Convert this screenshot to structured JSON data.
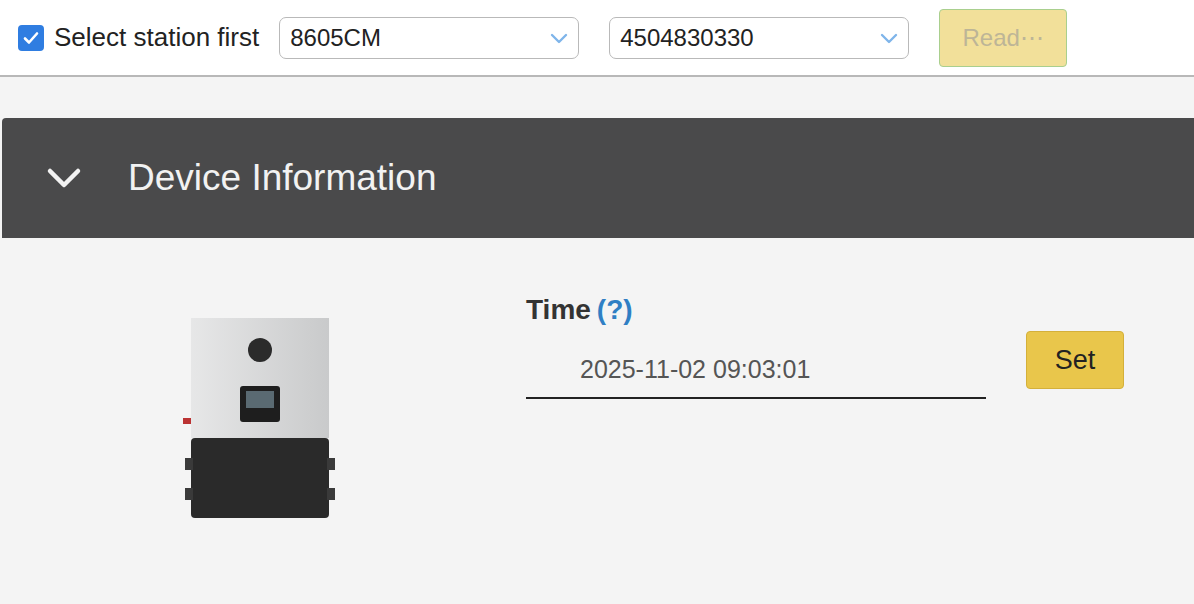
{
  "top_bar": {
    "select_station_first": {
      "label": "Select station first",
      "checked": true
    },
    "station_select": {
      "value": "8605CM"
    },
    "device_select": {
      "value": "4504830330"
    },
    "read_button": {
      "label": "Read⋯",
      "disabled": true
    }
  },
  "section": {
    "title": "Device Information",
    "expanded": true
  },
  "time_field": {
    "label": "Time",
    "help": "(?)",
    "value": "2025-11-02 09:03:01"
  },
  "set_button": {
    "label": "Set"
  }
}
